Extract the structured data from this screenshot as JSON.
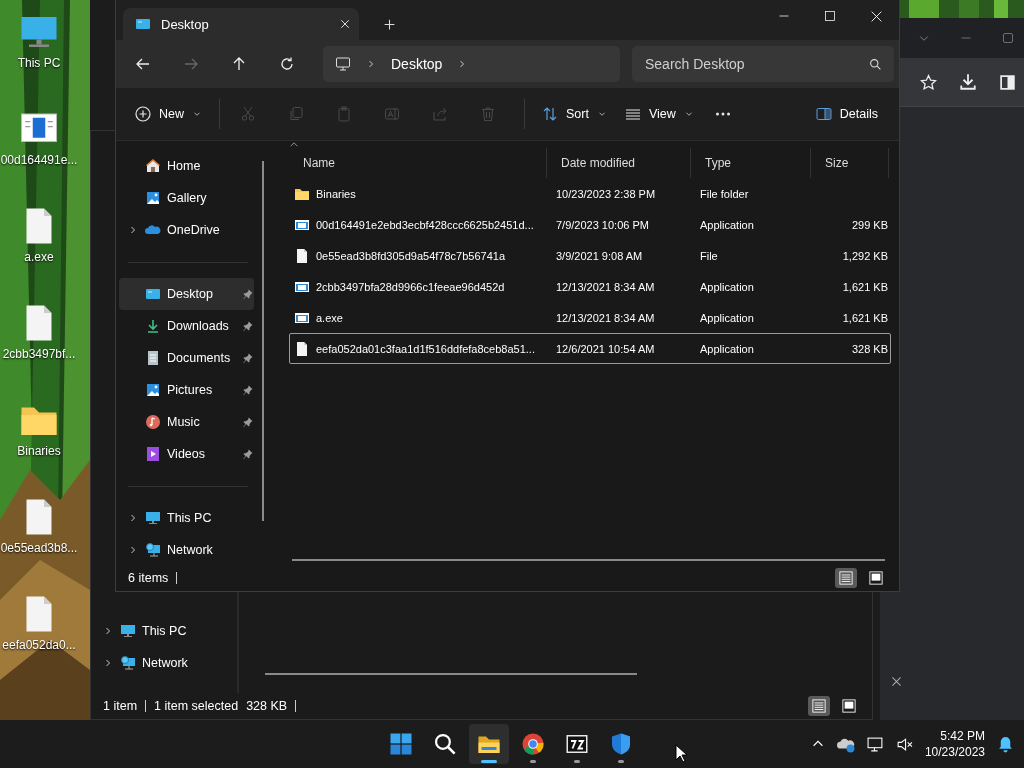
{
  "desktop": {
    "icons": [
      {
        "label": "This PC",
        "kind": "pc"
      },
      {
        "label": "00d164491e...",
        "kind": "app"
      },
      {
        "label": "a.exe",
        "kind": "file"
      },
      {
        "label": "2cbb3497bf...",
        "kind": "file"
      },
      {
        "label": "Binaries",
        "kind": "folder"
      },
      {
        "label": "0e55ead3b8...",
        "kind": "file"
      },
      {
        "label": "eefa052da0...",
        "kind": "file"
      }
    ]
  },
  "back_window": {
    "sidebar": {
      "items": [
        {
          "label": "This PC",
          "kind": "pc",
          "expandable": true
        },
        {
          "label": "Network",
          "kind": "network",
          "expandable": true
        }
      ]
    },
    "status_bar": {
      "items": "1 item",
      "selection": "1 item selected",
      "size": "328 KB"
    },
    "view_modes": [
      {
        "kind": "details",
        "selected": true
      },
      {
        "kind": "tiles",
        "selected": false
      }
    ]
  },
  "explorer": {
    "tabs": [
      {
        "title": "Desktop",
        "selected": true
      }
    ],
    "address": {
      "crumbs": [
        "Desktop"
      ]
    },
    "search": {
      "placeholder": "Search Desktop"
    },
    "command_bar": [
      {
        "kind": "new",
        "label": "New",
        "disabled": false
      },
      {
        "kind": "cut",
        "disabled": true
      },
      {
        "kind": "copy",
        "disabled": true
      },
      {
        "kind": "paste",
        "disabled": true
      },
      {
        "kind": "rename",
        "disabled": true
      },
      {
        "kind": "share",
        "disabled": true
      },
      {
        "kind": "delete",
        "disabled": true
      },
      {
        "kind": "sort",
        "label": "Sort",
        "disabled": false
      },
      {
        "kind": "view",
        "label": "View",
        "disabled": false
      },
      {
        "kind": "more",
        "disabled": false
      },
      {
        "kind": "details",
        "label": "Details",
        "disabled": false
      }
    ],
    "sidebar": {
      "groups": [
        {
          "items": [
            {
              "label": "Home",
              "kind": "home",
              "expandable": false,
              "pinned": false,
              "selected": false
            },
            {
              "label": "Gallery",
              "kind": "gallery",
              "expandable": false,
              "pinned": false,
              "selected": false
            },
            {
              "label": "OneDrive",
              "kind": "onedrive",
              "expandable": true,
              "pinned": false,
              "selected": false
            }
          ]
        },
        {
          "items": [
            {
              "label": "Desktop",
              "kind": "desktop",
              "expandable": false,
              "pinned": true,
              "selected": true
            },
            {
              "label": "Downloads",
              "kind": "downloads",
              "expandable": false,
              "pinned": true,
              "selected": false
            },
            {
              "label": "Documents",
              "kind": "documents",
              "expandable": false,
              "pinned": true,
              "selected": false
            },
            {
              "label": "Pictures",
              "kind": "pictures",
              "expandable": false,
              "pinned": true,
              "selected": false
            },
            {
              "label": "Music",
              "kind": "music",
              "expandable": false,
              "pinned": true,
              "selected": false
            },
            {
              "label": "Videos",
              "kind": "videos",
              "expandable": false,
              "pinned": true,
              "selected": false
            }
          ]
        },
        {
          "items": [
            {
              "label": "This PC",
              "kind": "pc",
              "expandable": true,
              "pinned": false,
              "selected": false
            },
            {
              "label": "Network",
              "kind": "network",
              "expandable": true,
              "pinned": false,
              "selected": false
            }
          ]
        }
      ]
    },
    "file_list": {
      "columns": [
        "Name",
        "Date modified",
        "Type",
        "Size"
      ],
      "rows": [
        {
          "name": "Binaries",
          "date": "10/23/2023 2:38 PM",
          "type": "File folder",
          "size": "",
          "kind": "folder",
          "selected": false
        },
        {
          "name": "00d164491e2ebd3ecbf428ccc6625b2451d...",
          "date": "7/9/2023 10:06 PM",
          "type": "Application",
          "size": "299 KB",
          "kind": "app",
          "selected": false
        },
        {
          "name": "0e55ead3b8fd305d9a54f78c7b56741a",
          "date": "3/9/2021 9:08 AM",
          "type": "File",
          "size": "1,292 KB",
          "kind": "file",
          "selected": false
        },
        {
          "name": "2cbb3497bfa28d9966c1feeae96d452d",
          "date": "12/13/2021 8:34 AM",
          "type": "Application",
          "size": "1,621 KB",
          "kind": "app",
          "selected": false
        },
        {
          "name": "a.exe",
          "date": "12/13/2021 8:34 AM",
          "type": "Application",
          "size": "1,621 KB",
          "kind": "app",
          "selected": false
        },
        {
          "name": "eefa052da01c3faa1d1f516ddfefa8ceb8a51...",
          "date": "12/6/2021 10:54 AM",
          "type": "Application",
          "size": "328 KB",
          "kind": "file",
          "selected": true
        }
      ]
    },
    "status_bar": {
      "items": "6 items"
    },
    "view_modes": [
      {
        "kind": "details",
        "selected": true
      },
      {
        "kind": "tiles",
        "selected": false
      }
    ]
  },
  "taskbar": {
    "apps": [
      {
        "kind": "start",
        "running": false,
        "active": false
      },
      {
        "kind": "search",
        "running": false,
        "active": false
      },
      {
        "kind": "explorer",
        "running": true,
        "active": true
      },
      {
        "kind": "chrome",
        "running": true,
        "active": false
      },
      {
        "kind": "sevenzip",
        "running": true,
        "active": false
      },
      {
        "kind": "defender",
        "running": true,
        "active": false
      }
    ],
    "clock": {
      "time": "5:42 PM",
      "date": "10/23/2023"
    }
  }
}
